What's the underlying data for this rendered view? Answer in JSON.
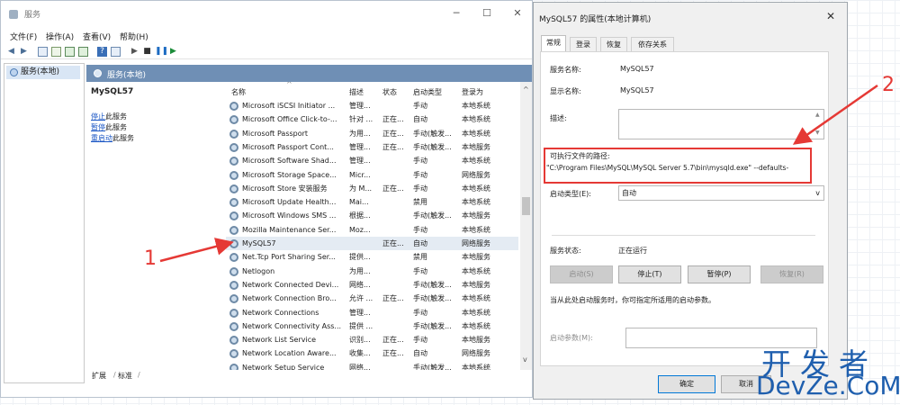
{
  "services_window": {
    "title": "服务",
    "controls": {
      "minimize": "─",
      "maximize": "☐",
      "close": "✕"
    },
    "menu": [
      "文件(F)",
      "操作(A)",
      "查看(V)",
      "帮助(H)"
    ],
    "toolbar_icons": [
      "back-arrow-icon",
      "forward-arrow-icon",
      "console-tree-icon",
      "properties-icon",
      "refresh-icon",
      "export-icon",
      "help-icon",
      "view-icon",
      "play-icon",
      "stop-icon",
      "pause-icon",
      "restart-icon"
    ],
    "tree": {
      "item": "服务(本地)"
    },
    "panel_header": "服务(本地)",
    "detail": {
      "service_name": "MySQL57",
      "links": [
        {
          "link": "停止",
          "rest": "此服务"
        },
        {
          "link": "暂停",
          "rest": "此服务"
        },
        {
          "link": "重启动",
          "rest": "此服务"
        }
      ]
    },
    "list": {
      "columns": [
        "名称",
        "描述",
        "状态",
        "启动类型",
        "登录为"
      ],
      "rows": [
        [
          "Microsoft iSCSI Initiator ...",
          "管理...",
          "",
          "手动",
          "本地系统"
        ],
        [
          "Microsoft Office Click-to-...",
          "针对 ...",
          "正在...",
          "自动",
          "本地系统"
        ],
        [
          "Microsoft Passport",
          "为用...",
          "正在...",
          "手动(触发...",
          "本地系统"
        ],
        [
          "Microsoft Passport Cont...",
          "管理...",
          "正在...",
          "手动(触发...",
          "本地服务"
        ],
        [
          "Microsoft Software Shad...",
          "管理...",
          "",
          "手动",
          "本地系统"
        ],
        [
          "Microsoft Storage Space...",
          "Micr...",
          "",
          "手动",
          "网络服务"
        ],
        [
          "Microsoft Store 安装服务",
          "为 M...",
          "正在...",
          "手动",
          "本地系统"
        ],
        [
          "Microsoft Update Health...",
          "Mai...",
          "",
          "禁用",
          "本地系统"
        ],
        [
          "Microsoft Windows SMS ...",
          "根据...",
          "",
          "手动(触发...",
          "本地服务"
        ],
        [
          "Mozilla Maintenance Ser...",
          "Moz...",
          "",
          "手动",
          "本地系统"
        ],
        [
          "MySQL57",
          "",
          "正在...",
          "自动",
          "网络服务"
        ],
        [
          "Net.Tcp Port Sharing Ser...",
          "提供...",
          "",
          "禁用",
          "本地服务"
        ],
        [
          "Netlogon",
          "为用...",
          "",
          "手动",
          "本地系统"
        ],
        [
          "Network Connected Devi...",
          "网络...",
          "",
          "手动(触发...",
          "本地服务"
        ],
        [
          "Network Connection Bro...",
          "允许 ...",
          "正在...",
          "手动(触发...",
          "本地系统"
        ],
        [
          "Network Connections",
          "管理...",
          "",
          "手动",
          "本地系统"
        ],
        [
          "Network Connectivity Ass...",
          "提供 ...",
          "",
          "手动(触发...",
          "本地系统"
        ],
        [
          "Network List Service",
          "识别...",
          "正在...",
          "手动",
          "本地服务"
        ],
        [
          "Network Location Aware...",
          "收集...",
          "正在...",
          "自动",
          "网络服务"
        ],
        [
          "Network Setup Service",
          "网络...",
          "",
          "手动(触发...",
          "本地系统"
        ]
      ],
      "selected_index": 10
    },
    "bottom_tabs": [
      "扩展",
      "标准"
    ]
  },
  "properties_dialog": {
    "title": "MySQL57 的属性(本地计算机)",
    "close": "✕",
    "tabs": [
      "常规",
      "登录",
      "恢复",
      "依存关系"
    ],
    "service_name_label": "服务名称:",
    "service_name": "MySQL57",
    "display_name_label": "显示名称:",
    "display_name": "MySQL57",
    "description_label": "描述:",
    "path_label": "可执行文件的路径:",
    "path": "\"C:\\Program Files\\MySQL\\MySQL Server 5.7\\bin\\mysqld.exe\" --defaults-",
    "startup_type_label": "启动类型(E):",
    "startup_type": "自动",
    "status_label": "服务状态:",
    "status": "正在运行",
    "buttons": {
      "start": "启动(S)",
      "stop": "停止(T)",
      "pause": "暂停(P)",
      "resume": "恢复(R)"
    },
    "hint": "当从此处启动服务时，你可指定所适用的启动参数。",
    "params_label": "启动参数(M):",
    "ok": "确定",
    "cancel": "取消"
  },
  "annotations": {
    "one": "1",
    "two": "2",
    "color": "#e53935"
  },
  "watermark": {
    "top": "开发者",
    "bottom": "DevZe.CoM"
  }
}
